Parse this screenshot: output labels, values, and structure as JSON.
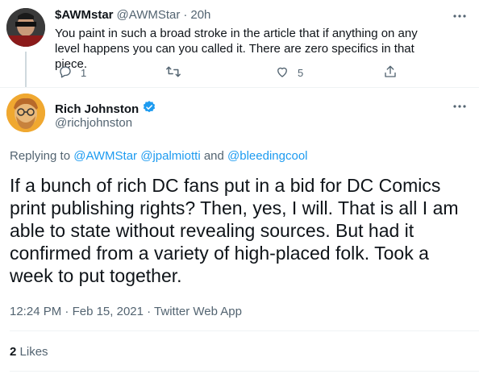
{
  "reply_tweet": {
    "display_name": "$AWMstar",
    "handle": "@AWMStar",
    "dot": "·",
    "time": "20h",
    "text": "You paint in such a broad stroke in the article that if anything on any level happens you can you called it.   There are zero specifics in that piece.",
    "reply_count": "1",
    "retweet_count": "",
    "like_count": "5"
  },
  "main_tweet": {
    "display_name": "Rich Johnston",
    "handle": "@richjohnston",
    "replying_prefix": "Replying to",
    "replying_to": [
      "@AWMStar",
      "@jpalmiotti",
      "@bleedingcool"
    ],
    "replying_and": "and",
    "text": "If a bunch of rich DC fans put in a bid for DC Comics print publishing rights? Then, yes, I will. That is all I am able to state without revealing sources. But had it confirmed from a variety of high-placed folk. Took a week to put together.",
    "time": "12:24 PM",
    "dot": "·",
    "date": "Feb 15, 2021",
    "source": "Twitter Web App",
    "likes_count": "2",
    "likes_label": "Likes"
  },
  "colors": {
    "accent": "#1d9bf0",
    "muted": "#536471",
    "text": "#0f1419",
    "border": "#eff3f4"
  }
}
